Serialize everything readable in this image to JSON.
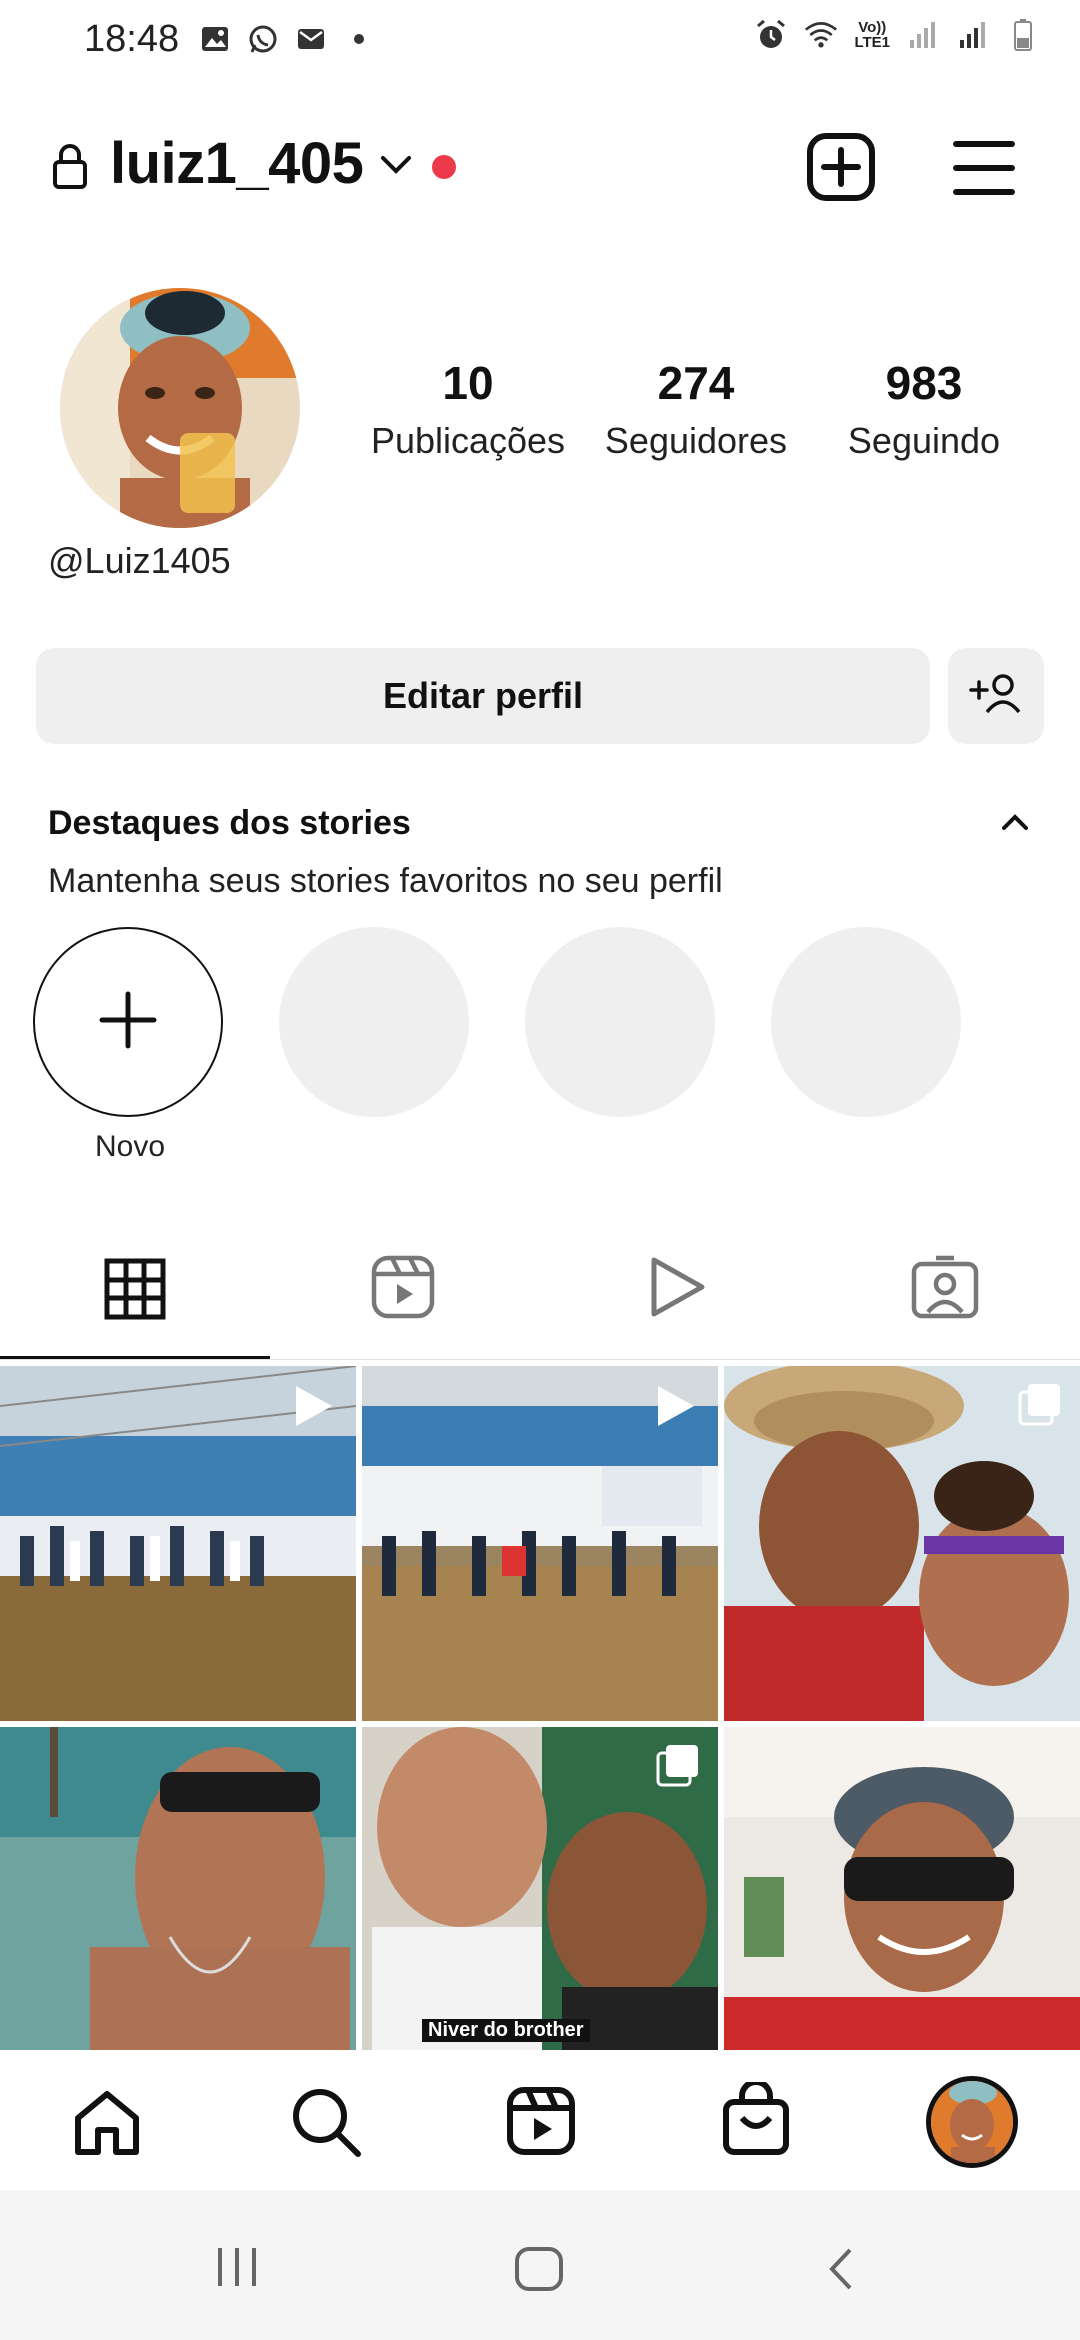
{
  "status_bar": {
    "time": "18:48",
    "volte_top": "Vo))",
    "volte_bottom": "LTE1",
    "icons": [
      "gallery-icon",
      "whatsapp-icon",
      "mail-icon",
      "dot-icon",
      "alarm-icon",
      "wifi-icon",
      "signal-icon",
      "battery-icon"
    ]
  },
  "header": {
    "username": "luiz1_405",
    "icons": [
      "lock-icon",
      "chevron-down-icon",
      "create-plus-icon",
      "menu-icon"
    ],
    "notification_color": "#ed3a4a"
  },
  "profile": {
    "stats": [
      {
        "value": "10",
        "label": "Publicações"
      },
      {
        "value": "274",
        "label": "Seguidores"
      },
      {
        "value": "983",
        "label": "Seguindo"
      }
    ],
    "handle": "@Luiz1405"
  },
  "actions": {
    "edit_label": "Editar perfil"
  },
  "highlights": {
    "title": "Destaques dos stories",
    "subtitle": "Mantenha seus stories favoritos no seu perfil",
    "new_label": "Novo"
  },
  "tabs": [
    "grid-icon",
    "reels-icon",
    "play-icon",
    "tagged-icon"
  ],
  "posts": [
    {
      "caption": "",
      "type": "reel"
    },
    {
      "caption": "",
      "type": "reel"
    },
    {
      "caption": "",
      "type": "carousel"
    },
    {
      "caption": "",
      "type": "photo"
    },
    {
      "caption": "Niver do brother",
      "type": "carousel"
    },
    {
      "caption": "",
      "type": "photo"
    }
  ],
  "bottom_nav": [
    "home-icon",
    "search-icon",
    "reels-icon",
    "shop-icon",
    "profile-avatar"
  ],
  "system_nav": [
    "recents-icon",
    "home-button-icon",
    "back-icon"
  ]
}
